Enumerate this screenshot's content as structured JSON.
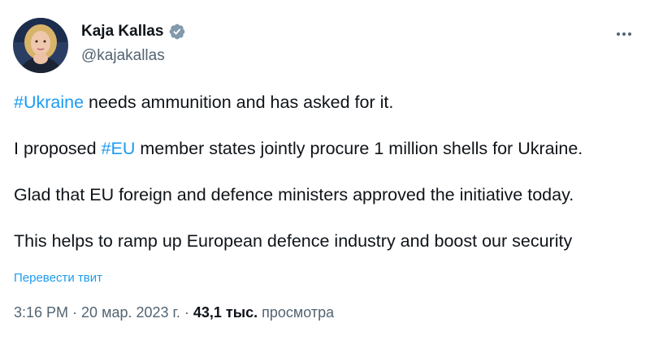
{
  "author": {
    "display_name": "Kaja Kallas",
    "handle": "@kajakallas",
    "verified": true,
    "avatar_icon": "profile-photo"
  },
  "tweet": {
    "paragraphs": [
      {
        "hashtag": "#Ukraine",
        "text": " needs ammunition and has asked for it."
      },
      {
        "pre": "I proposed ",
        "hashtag": "#EU",
        "text": " member states jointly procure 1 million shells for Ukraine."
      },
      {
        "text": "Glad that EU foreign and defence ministers approved the initiative today."
      },
      {
        "text": "This helps to ramp up European defence industry and boost our security"
      }
    ],
    "translate_label": "Перевести твит"
  },
  "meta": {
    "time": "3:16 PM",
    "separator": " · ",
    "date": "20 мар. 2023 г.",
    "views_count": "43,1 тыс.",
    "views_label": " просмотра"
  },
  "colors": {
    "link": "#1d9bf0",
    "text": "#0f1419",
    "secondary": "#536471",
    "verified_badge": "#829aab"
  },
  "icons": {
    "more": "more-horizontal-icon",
    "verified": "verified-badge-icon"
  }
}
